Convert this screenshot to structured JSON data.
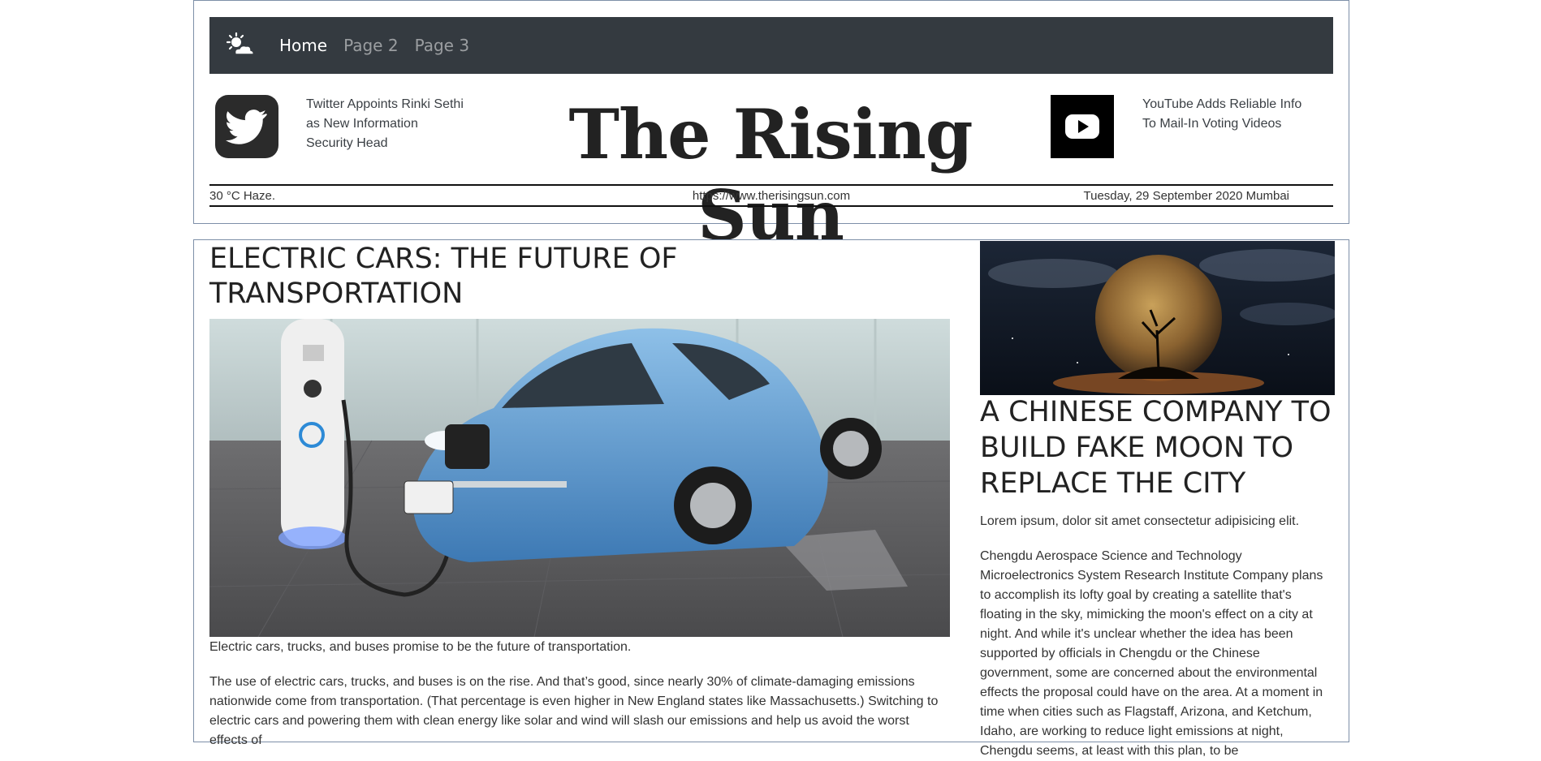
{
  "navbar": {
    "brand_icon": "sun-cloud-icon",
    "links": [
      {
        "label": "Home",
        "active": true
      },
      {
        "label": "Page 2",
        "active": false
      },
      {
        "label": "Page 3",
        "active": false
      }
    ]
  },
  "header": {
    "left_icon": "twitter-icon",
    "left_headline": "Twitter Appoints Rinki Sethi as New Information Security Head",
    "title": "The Rising Sun",
    "right_icon": "youtube-icon",
    "right_headline": "YouTube Adds Reliable Info To Mail-In Voting Videos",
    "weather": "30 °C Haze.",
    "url": "https://www.therisingsun.com",
    "date": "Tuesday, 29 September 2020 Mumbai"
  },
  "lead": {
    "title": "ELECTRIC CARS: THE FUTURE OF TRANSPORTATION",
    "caption": "Electric cars, trucks, and buses promise to be the future of transportation.",
    "body": "The use of electric cars, trucks, and buses is on the rise. And that’s good, since nearly 30% of climate-damaging emissions nationwide come from transportation. (That percentage is even higher in New England states like Massachusetts.) Switching to electric cars and powering them with clean energy like solar and wind will slash our emissions and help us avoid the worst effects of"
  },
  "side": {
    "title": "A CHINESE COMPANY TO BUILD FAKE MOON TO REPLACE THE CITY",
    "subtitle": "Lorem ipsum, dolor sit amet consectetur adipisicing elit.",
    "body": "Chengdu Aerospace Science and Technology Microelectronics System Research Institute Company plans to accomplish its lofty goal by creating a satellite that's floating in the sky, mimicking the moon's effect on a city at night. And while it's unclear whether the idea has been supported by officials in Chengdu or the Chinese government, some are concerned about the environmental effects the proposal could have on the area. At a moment in time when cities such as Flagstaff, Arizona, and Ketchum, Idaho, are working to reduce light emissions at night, Chengdu seems, at least with this plan, to be"
  },
  "colors": {
    "navbar_bg": "#343a40",
    "border": "#7d8fa8",
    "text": "#212529"
  }
}
